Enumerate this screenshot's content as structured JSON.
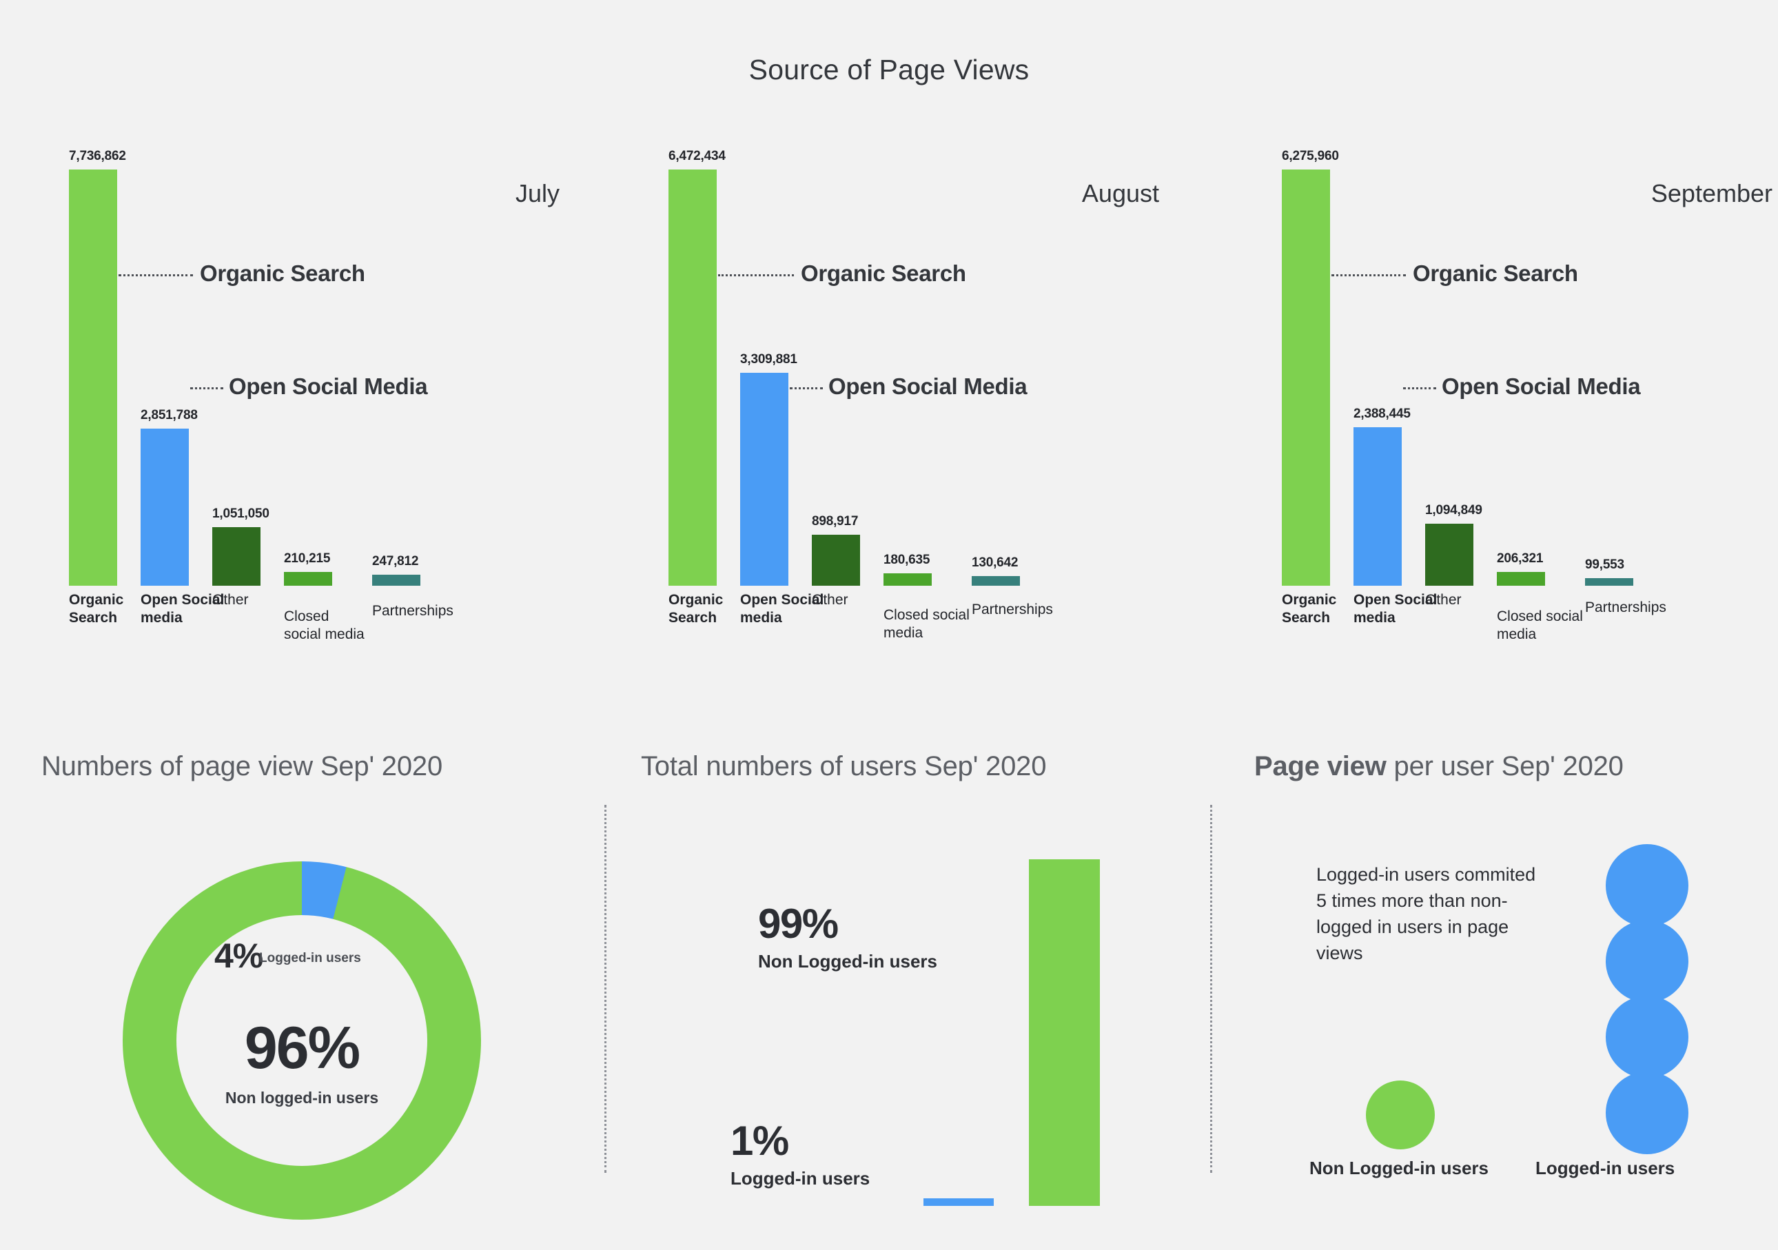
{
  "title": "Source of Page Views",
  "colors": {
    "background": "#f2f2f2",
    "organic_search": "#7ed14f",
    "open_social_media": "#4a9cf5",
    "other": "#2e6b1f",
    "closed_social_media": "#4ba52b",
    "partnerships": "#37807c",
    "text_dark": "#2c2e33",
    "text_muted": "#5b5e64"
  },
  "chart_data": [
    {
      "type": "bar",
      "title": "July",
      "categories": [
        "Organic Search",
        "Open Social media",
        "Other",
        "Closed social media",
        "Partnerships"
      ],
      "values": [
        7736862,
        2851788,
        1051050,
        210215,
        247812
      ],
      "value_labels": [
        "7,736,862",
        "2,851,788",
        "1,051,050",
        "210,215",
        "247,812"
      ],
      "colors": [
        "#7ed14f",
        "#4a9cf5",
        "#2e6b1f",
        "#4ba52b",
        "#37807c"
      ],
      "callouts": [
        {
          "label": "Organic Search",
          "series": "Organic Search"
        },
        {
          "label": "Open Social Media",
          "series": "Open Social media"
        }
      ],
      "xlabel": "",
      "ylabel": "",
      "grid": false,
      "legend": "none"
    },
    {
      "type": "bar",
      "title": "August",
      "categories": [
        "Organic Search",
        "Open Social media",
        "Other",
        "Closed social media",
        "Partnerships"
      ],
      "values": [
        6472434,
        3309881,
        898917,
        180635,
        130642
      ],
      "value_labels": [
        "6,472,434",
        "3,309,881",
        "898,917",
        "180,635",
        "130,642"
      ],
      "colors": [
        "#7ed14f",
        "#4a9cf5",
        "#2e6b1f",
        "#4ba52b",
        "#37807c"
      ],
      "callouts": [
        {
          "label": "Organic Search",
          "series": "Organic Search"
        },
        {
          "label": "Open Social Media",
          "series": "Open Social media"
        }
      ],
      "xlabel": "",
      "ylabel": "",
      "grid": false,
      "legend": "none"
    },
    {
      "type": "bar",
      "title": "September",
      "categories": [
        "Organic Search",
        "Open Social media",
        "Other",
        "Closed social media",
        "Partnerships"
      ],
      "values": [
        6275960,
        2388445,
        1094849,
        206321,
        99553
      ],
      "value_labels": [
        "6,275,960",
        "2,388,445",
        "1,094,849",
        "206,321",
        "99,553"
      ],
      "colors": [
        "#7ed14f",
        "#4a9cf5",
        "#2e6b1f",
        "#4ba52b",
        "#37807c"
      ],
      "callouts": [
        {
          "label": "Organic Search",
          "series": "Organic Search"
        },
        {
          "label": "Open Social Media",
          "series": "Open Social media"
        }
      ],
      "xlabel": "",
      "ylabel": "",
      "grid": false,
      "legend": "none"
    },
    {
      "type": "pie",
      "title": "Numbers of page view Sep' 2020",
      "labels": [
        "Non logged-in users",
        "Logged-in users"
      ],
      "values": [
        96,
        4
      ],
      "value_labels": [
        "96%",
        "4%"
      ],
      "colors": [
        "#7ed14f",
        "#4a9cf5"
      ],
      "donut": true,
      "legend": "inside"
    },
    {
      "type": "bar",
      "title": "Total numbers of users Sep' 2020",
      "categories": [
        "Logged-in users",
        "Non Logged-in users"
      ],
      "values": [
        1,
        99
      ],
      "value_labels": [
        "1%",
        "99%"
      ],
      "colors": [
        "#4a9cf5",
        "#7ed14f"
      ],
      "ylim": [
        0,
        100
      ],
      "xlabel": "",
      "ylabel": "",
      "grid": false,
      "legend": "none"
    },
    {
      "type": "bar",
      "title": "Page view per user Sep' 2020",
      "categories": [
        "Non Logged-in users",
        "Logged-in users"
      ],
      "values": [
        1,
        4
      ],
      "unit": "pictogram circles",
      "colors": [
        "#7ed14f",
        "#4a9cf5"
      ],
      "annotation": "Logged-in users commited 5 times more than non-logged in users in page views",
      "legend": "bottom"
    }
  ],
  "months": {
    "july": {
      "name": "July",
      "bars": [
        {
          "label_line1": "Organic",
          "label_line2": "Search",
          "value": "7,736,862"
        },
        {
          "label_line1": "Open Social",
          "label_line2": "media",
          "value": "2,851,788"
        },
        {
          "label_line1": "Other",
          "label_line2": "",
          "value": "1,051,050"
        },
        {
          "label_line1": "Closed",
          "label_line2": "social media",
          "value": "210,215"
        },
        {
          "label_line1": "Partnerships",
          "label_line2": "",
          "value": "247,812"
        }
      ],
      "callout_organic": "Organic Search",
      "callout_social": "Open Social Media"
    },
    "august": {
      "name": "August",
      "bars": [
        {
          "label_line1": "Organic",
          "label_line2": "Search",
          "value": "6,472,434"
        },
        {
          "label_line1": "Open Social",
          "label_line2": "media",
          "value": "3,309,881"
        },
        {
          "label_line1": "Other",
          "label_line2": "",
          "value": "898,917"
        },
        {
          "label_line1": "Closed social",
          "label_line2": "media",
          "value": "180,635"
        },
        {
          "label_line1": "Partnerships",
          "label_line2": "",
          "value": "130,642"
        }
      ],
      "callout_organic": "Organic Search",
      "callout_social": "Open Social Media"
    },
    "september": {
      "name": "September",
      "bars": [
        {
          "label_line1": "Organic",
          "label_line2": "Search",
          "value": "6,275,960"
        },
        {
          "label_line1": "Open Social",
          "label_line2": "media",
          "value": "2,388,445"
        },
        {
          "label_line1": "Other",
          "label_line2": "",
          "value": "1,094,849"
        },
        {
          "label_line1": "Closed social",
          "label_line2": "media",
          "value": "206,321"
        },
        {
          "label_line1": "Partnerships",
          "label_line2": "",
          "value": "99,553"
        }
      ],
      "callout_organic": "Organic Search",
      "callout_social": "Open Social Media"
    }
  },
  "pageviews_panel": {
    "title": "Numbers of page view Sep' 2020",
    "small_pct": "4%",
    "small_label": "Logged-in users",
    "big_pct": "96%",
    "big_label": "Non logged-in users"
  },
  "users_panel": {
    "title": "Total numbers of users Sep' 2020",
    "top_pct": "99%",
    "top_label": "Non Logged-in users",
    "bottom_pct": "1%",
    "bottom_label": "Logged-in users"
  },
  "peruser_panel": {
    "title_strong": "Page view",
    "title_rest": " per user Sep' 2020",
    "body": "Logged-in users commited 5 times more than non-logged in users in page views",
    "legend_left": "Non Logged-in users",
    "legend_right": "Logged-in users"
  }
}
